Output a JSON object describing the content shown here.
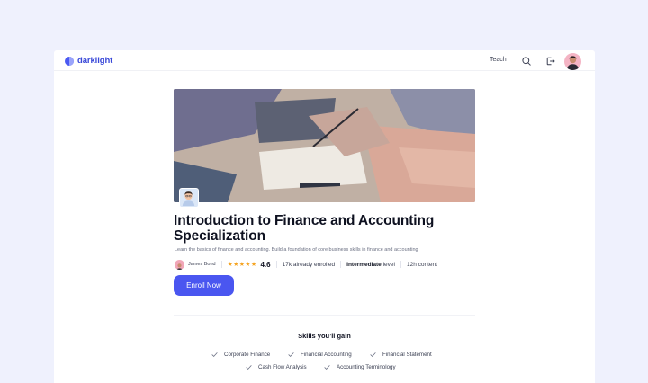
{
  "brand": {
    "name": "darklight",
    "color": "#4a59f2"
  },
  "nav": {
    "teach": "Teach",
    "search_icon": "search-icon",
    "logout_icon": "logout-icon"
  },
  "course": {
    "title_line1": "Introduction to Finance and Accounting",
    "title_line2": "Specialization",
    "subtitle": "Learn the basics of finance and accounting. Build a foundation of core business skills in finance and accounting",
    "author": "James Bond",
    "stars": "★★★★★",
    "rating": "4.6",
    "enrolled": "17k already enrolled",
    "level_value": "Intermediate",
    "level_suffix": "level",
    "content": "12h content",
    "enroll_label": "Enroll Now"
  },
  "skills": {
    "title": "Skills you’ll gain",
    "items": [
      "Corporate Finance",
      "Financial Accounting",
      "Financial Statement",
      "Cash Flow Analysis",
      "Accounting Terminology"
    ]
  },
  "colors": {
    "accent": "#4a56f0",
    "background": "#eff1fd",
    "star": "#f5a524"
  }
}
